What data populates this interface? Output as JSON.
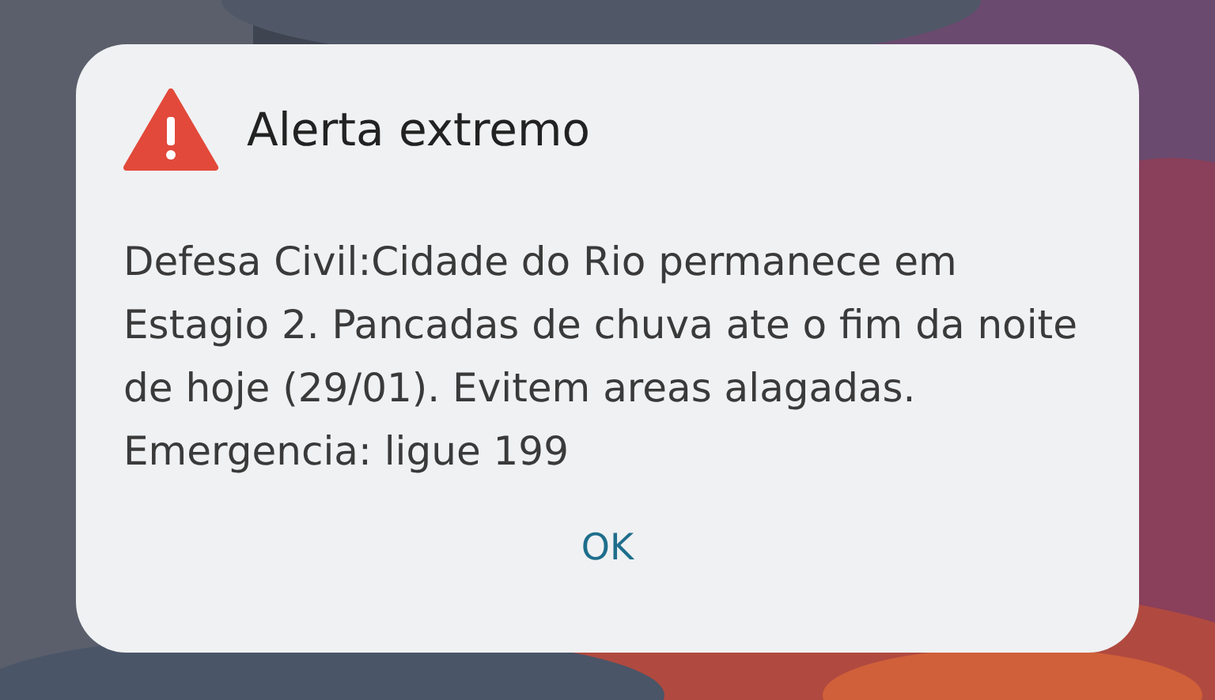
{
  "alert": {
    "title": "Alerta extremo",
    "message": "Defesa Civil:Cidade do Rio permanece em Estagio 2. Pancadas de chuva ate o fim da noite de hoje (29/01). Evitem areas alagadas. Emergencia: ligue 199",
    "button": "OK"
  }
}
